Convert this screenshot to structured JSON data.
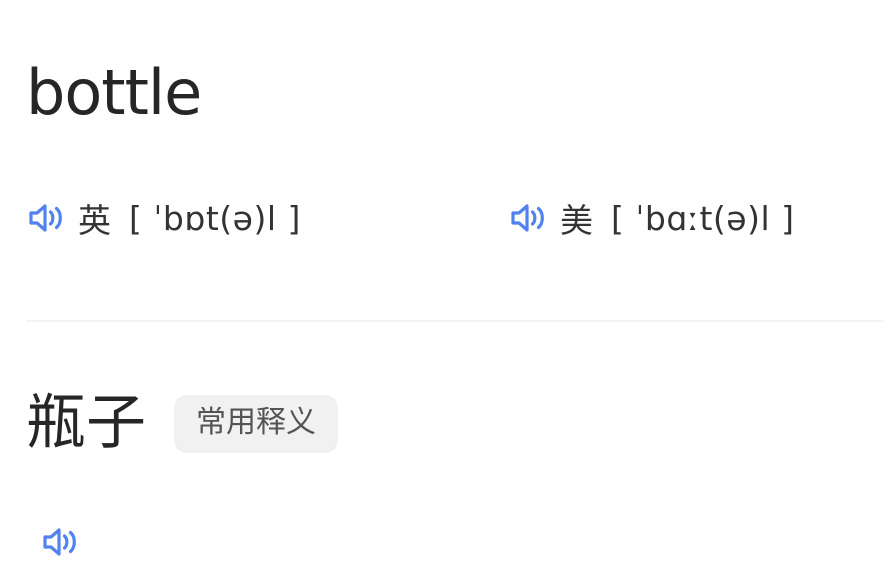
{
  "entry": {
    "headword": "bottle",
    "pronunciations": [
      {
        "locale_label": "英",
        "ipa": "[ ˈbɒt(ə)l ]",
        "speaker_icon": "speaker-icon"
      },
      {
        "locale_label": "美",
        "ipa": "[ ˈbɑːt(ə)l ]",
        "speaker_icon": "speaker-icon"
      }
    ],
    "definition": {
      "text": "瓶子",
      "badge": "常用释义"
    }
  },
  "colors": {
    "accent_blue": "#5183f0",
    "text_dark": "#262626",
    "text_body": "#333333",
    "badge_bg": "#f1f1f2",
    "badge_text": "#545454",
    "divider": "#f4f4f5",
    "background": "#ffffff"
  }
}
